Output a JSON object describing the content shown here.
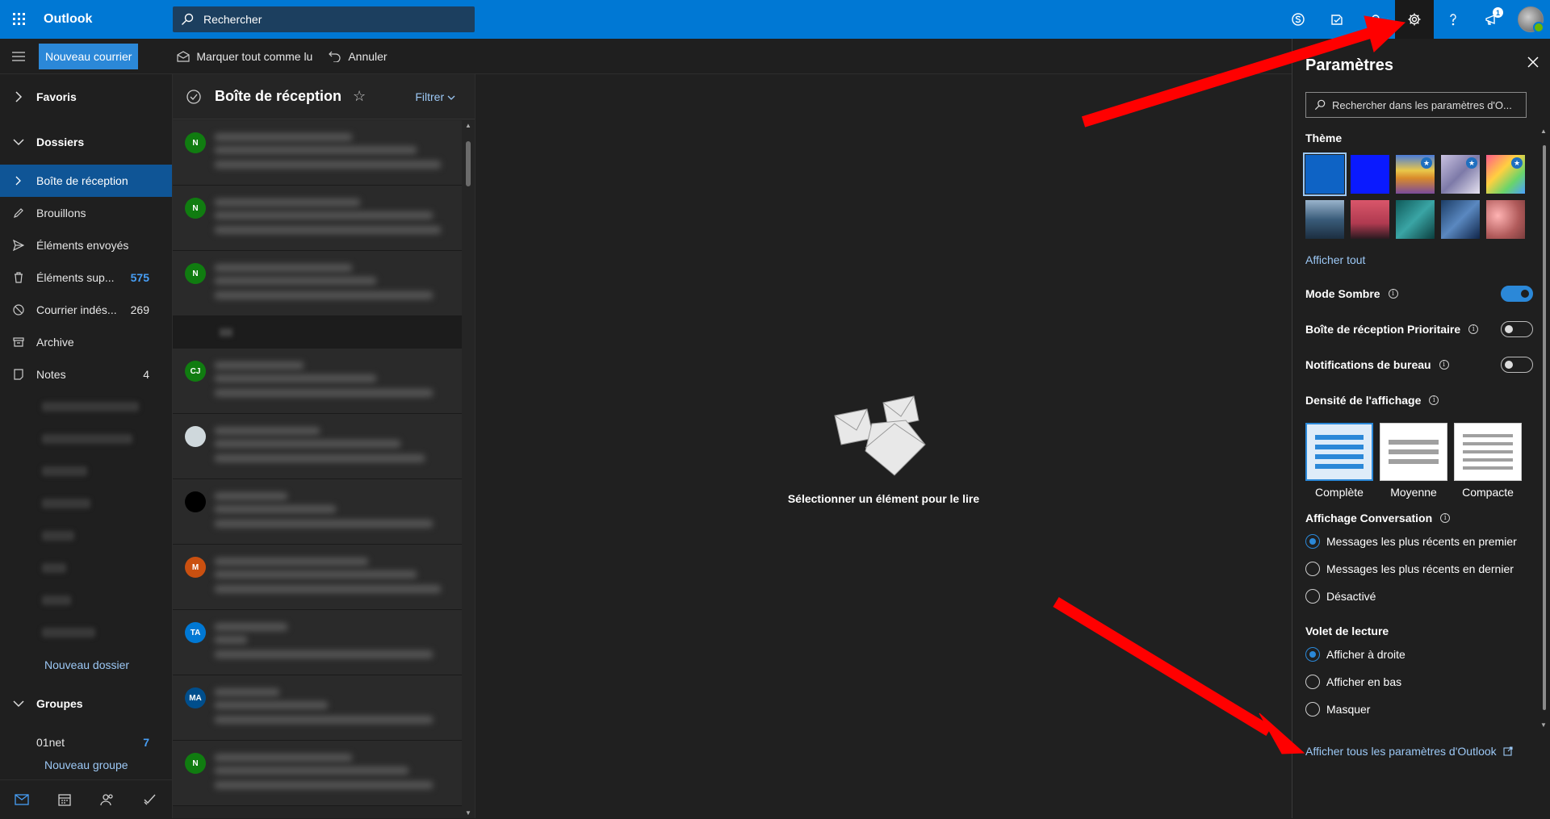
{
  "topbar": {
    "brand": "Outlook",
    "search_placeholder": "Rechercher",
    "notif_count": "1",
    "icons": [
      "skype-icon",
      "todo-icon",
      "bell-icon",
      "gear-icon",
      "help-icon",
      "feedback-icon",
      "avatar"
    ]
  },
  "commandbar": {
    "new_mail": "Nouveau courrier",
    "mark_read": "Marquer tout comme lu",
    "undo": "Annuler"
  },
  "nav": {
    "favoris": "Favoris",
    "dossiers": "Dossiers",
    "items": [
      {
        "label": "Boîte de réception",
        "count": "",
        "icon": "chevron-right-icon",
        "selected": true
      },
      {
        "label": "Brouillons",
        "count": "",
        "icon": "pencil-icon"
      },
      {
        "label": "Éléments envoyés",
        "count": "",
        "icon": "send-icon"
      },
      {
        "label": "Éléments sup...",
        "count": "575",
        "icon": "trash-icon"
      },
      {
        "label": "Courrier indés...",
        "count": "269",
        "icon": "block-icon"
      },
      {
        "label": "Archive",
        "count": "",
        "icon": "archive-icon"
      },
      {
        "label": "Notes",
        "count": "4",
        "icon": "notes-icon"
      }
    ],
    "new_folder": "Nouveau dossier",
    "groupes": "Groupes",
    "group_item": {
      "label": "01net",
      "count": "7"
    },
    "new_group": "Nouveau groupe"
  },
  "list": {
    "title": "Boîte de réception",
    "filter": "Filtrer",
    "avatars": [
      {
        "initials": "N",
        "color": "#107c10"
      },
      {
        "initials": "N",
        "color": "#107c10"
      },
      {
        "initials": "N",
        "color": "#107c10"
      },
      {
        "initials": "CJ",
        "color": "#107c10"
      },
      {
        "initials": "",
        "color": "#cfd8dc"
      },
      {
        "initials": "",
        "color": "#000000"
      },
      {
        "initials": "M",
        "color": "#ca5010"
      },
      {
        "initials": "TA",
        "color": "#0078d4"
      },
      {
        "initials": "MA",
        "color": "#004e8c"
      },
      {
        "initials": "N",
        "color": "#107c10"
      }
    ]
  },
  "reading": {
    "empty_text": "Sélectionner un élément pour le lire"
  },
  "settings": {
    "title": "Paramètres",
    "search_placeholder": "Rechercher dans les paramètres d'O...",
    "theme_label": "Thème",
    "show_all": "Afficher tout",
    "dark_mode": "Mode Sombre",
    "focused_inbox": "Boîte de réception Prioritaire",
    "desktop_notifications": "Notifications de bureau",
    "density_label": "Densité de l'affichage",
    "density": [
      "Complète",
      "Moyenne",
      "Compacte"
    ],
    "conversation_label": "Affichage Conversation",
    "conversation_options": [
      "Messages les plus récents en premier",
      "Messages les plus récents en dernier",
      "Désactivé"
    ],
    "reading_pane_label": "Volet de lecture",
    "reading_pane_options": [
      "Afficher à droite",
      "Afficher en bas",
      "Masquer"
    ],
    "all_settings": "Afficher tous les paramètres d'Outlook",
    "dark_mode_on": true,
    "focused_inbox_on": false,
    "desktop_notifications_on": false
  },
  "colors": {
    "accent": "#0078d4",
    "link": "#9cc8f5",
    "arrow": "#ff0000"
  }
}
